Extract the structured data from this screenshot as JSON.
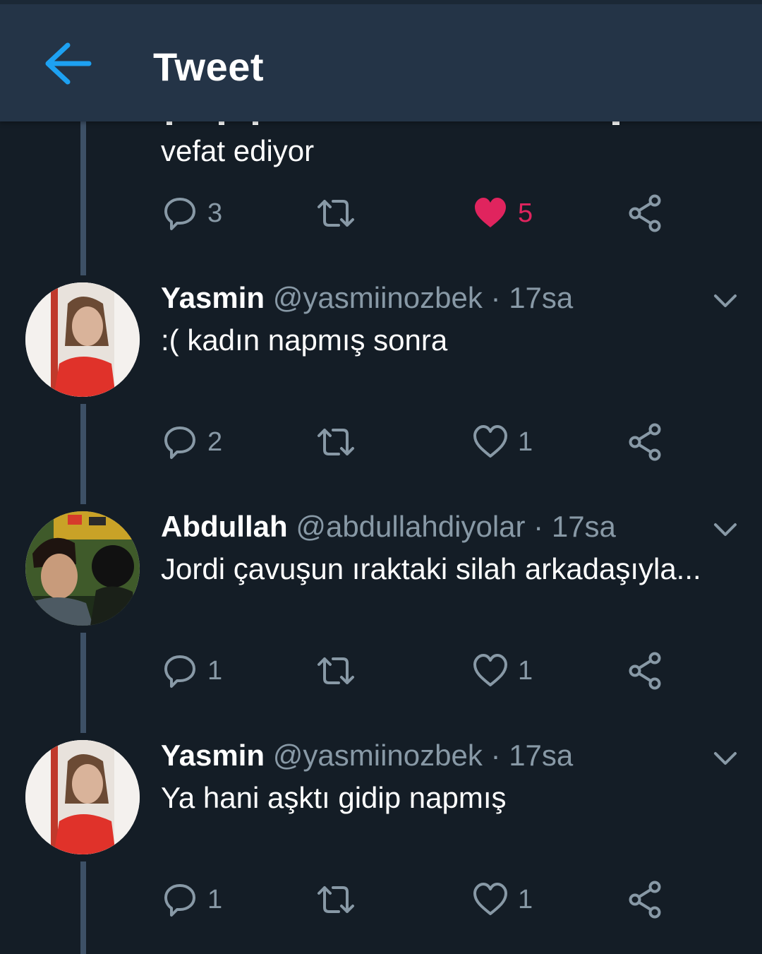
{
  "header": {
    "title": "Tweet",
    "back_icon": "arrow-left-icon",
    "accent": "#1da1f2"
  },
  "colors": {
    "background": "#141d26",
    "header": "#243447",
    "muted": "#8899a6",
    "like": "#e0245e"
  },
  "partial_tweet": {
    "text": "vefat ediyor",
    "actions": {
      "reply": "3",
      "retweet": "",
      "like": "5",
      "liked": true
    }
  },
  "replies": [
    {
      "name": "Yasmin",
      "handle": "@yasmiinozbek",
      "separator": "·",
      "time": "17sa",
      "text": ":( kadın napmış sonra",
      "actions": {
        "reply": "2",
        "retweet": "",
        "like": "1",
        "liked": false
      }
    },
    {
      "name": "Abdullah",
      "handle": "@abdullahdiyolar",
      "separator": "·",
      "time": "17sa",
      "text": "Jordi çavuşun ıraktaki silah arkadaşıyla...",
      "actions": {
        "reply": "1",
        "retweet": "",
        "like": "1",
        "liked": false
      }
    },
    {
      "name": "Yasmin",
      "handle": "@yasmiinozbek",
      "separator": "·",
      "time": "17sa",
      "text": "Ya hani aşktı gidip napmış",
      "actions": {
        "reply": "1",
        "retweet": "",
        "like": "1",
        "liked": false
      }
    }
  ]
}
